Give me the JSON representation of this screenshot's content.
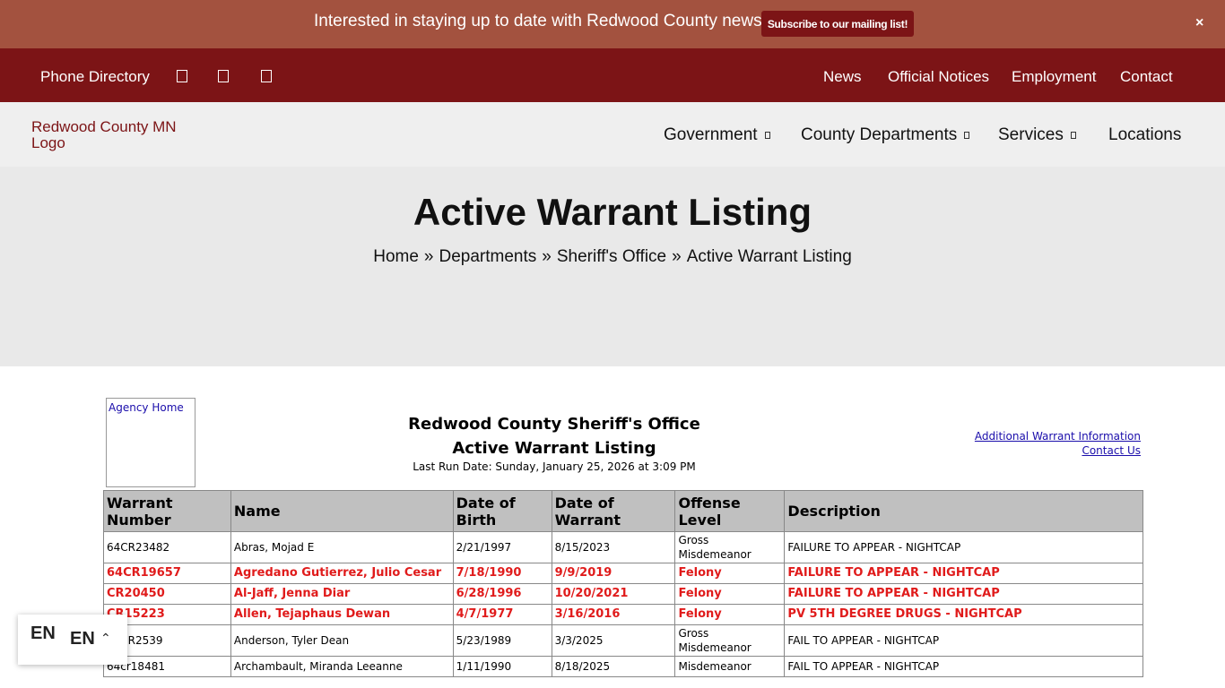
{
  "announcement": {
    "text": "Interested in staying up to date with Redwood County news?",
    "button_label": "Subscribe to our mailing list!",
    "close_label": "×"
  },
  "utility_bar": {
    "phone_directory": "Phone Directory",
    "icon_names": [
      "facebook-icon",
      "twitter-icon",
      "youtube-icon"
    ],
    "links": [
      "News",
      "Official Notices",
      "Employment",
      "Contact"
    ]
  },
  "header": {
    "logo_alt": "Redwood County MN Logo",
    "nav": [
      "Government",
      "County Departments",
      "Services",
      "Locations"
    ]
  },
  "hero": {
    "title": "Active Warrant Listing",
    "breadcrumb": [
      "Home",
      "Departments",
      "Sheriff's Office",
      "Active Warrant Listing"
    ],
    "breadcrumb_separator": "»"
  },
  "listing": {
    "agency_home_alt": "Agency Home",
    "office": "Redwood County Sheriff's Office",
    "title": "Active Warrant Listing",
    "last_run": "Last Run Date: Sunday, January 25, 2026 at 3:09 PM",
    "additional_info_link": "Additional Warrant Information",
    "contact_link": "Contact Us",
    "columns": [
      "Warrant Number",
      "Name",
      "Date of Birth",
      "Date of Warrant",
      "Offense Level",
      "Description"
    ],
    "rows": [
      {
        "warrant": "64CR23482",
        "name": "Abras, Mojad E",
        "dob": "2/21/1997",
        "date": "8/15/2023",
        "level": "Gross Misdemeanor",
        "desc": "FAILURE TO APPEAR - NIGHTCAP",
        "felony": false
      },
      {
        "warrant": "64CR19657",
        "name": "Agredano Gutierrez, Julio Cesar",
        "dob": "7/18/1990",
        "date": "9/9/2019",
        "level": "Felony",
        "desc": "FAILURE TO APPEAR - NIGHTCAP",
        "felony": true
      },
      {
        "warrant": "CR20450",
        "name": "Al-Jaff, Jenna Diar",
        "dob": "6/28/1996",
        "date": "10/20/2021",
        "level": "Felony",
        "desc": "FAILURE TO APPEAR - NIGHTCAP",
        "felony": true
      },
      {
        "warrant": "CR15223",
        "name": "Allen, Tejaphaus Dewan",
        "dob": "4/7/1977",
        "date": "3/16/2016",
        "level": "Felony",
        "desc": "PV 5TH DEGREE DRUGS - NIGHTCAP",
        "felony": true
      },
      {
        "warrant": "64CR2539",
        "name": "Anderson, Tyler Dean",
        "dob": "5/23/1989",
        "date": "3/3/2025",
        "level": "Gross Misdemeanor",
        "desc": "FAIL TO APPEAR - NIGHTCAP",
        "felony": false
      },
      {
        "warrant": "64cr18481",
        "name": "Archambault, Miranda Leeanne",
        "dob": "1/11/1990",
        "date": "8/18/2025",
        "level": "Misdemeanor",
        "desc": "FAIL TO APPEAR - NIGHTCAP",
        "felony": false
      }
    ]
  },
  "language": {
    "flag": "EN",
    "code": "EN",
    "caret": "⌃"
  }
}
